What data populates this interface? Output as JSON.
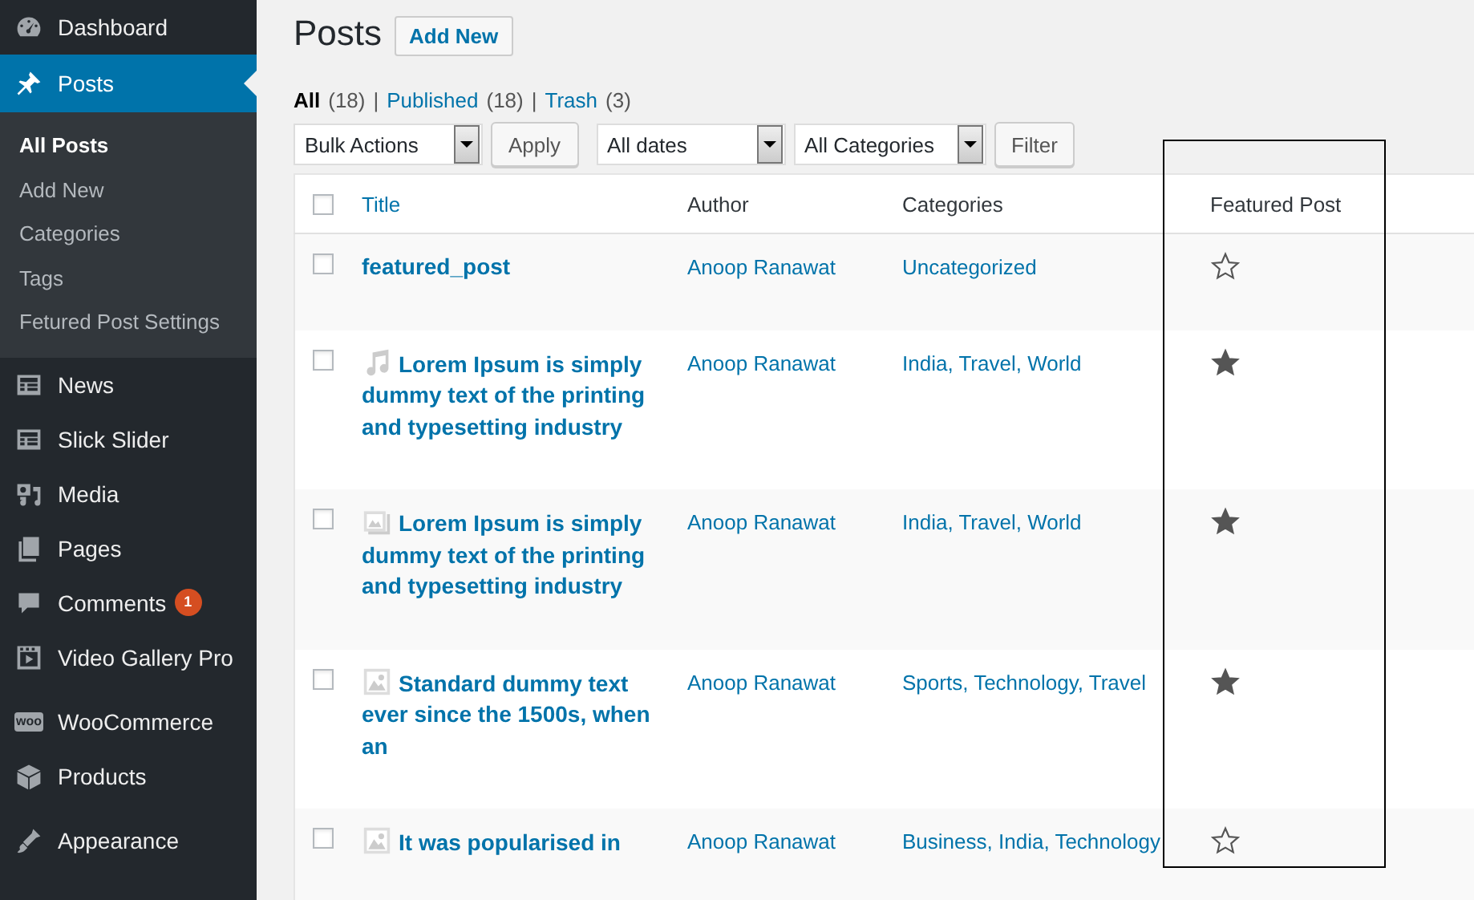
{
  "sidebar": {
    "items": [
      {
        "label": "Dashboard",
        "kind": "dashboard",
        "selected": false
      },
      {
        "label": "Posts",
        "kind": "pin",
        "selected": true,
        "submenu": [
          {
            "label": "All Posts",
            "selected": true
          },
          {
            "label": "Add New",
            "selected": false
          },
          {
            "label": "Categories",
            "selected": false
          },
          {
            "label": "Tags",
            "selected": false
          },
          {
            "label": "Fetured Post Settings",
            "selected": false
          }
        ]
      },
      {
        "label": "News",
        "kind": "list",
        "selected": false
      },
      {
        "label": "Slick Slider",
        "kind": "list",
        "selected": false
      },
      {
        "label": "Media",
        "kind": "media",
        "selected": false
      },
      {
        "label": "Pages",
        "kind": "pages",
        "selected": false
      },
      {
        "label": "Comments",
        "kind": "comment",
        "selected": false,
        "badge": "1"
      },
      {
        "label": "Video Gallery Pro",
        "kind": "video",
        "selected": false
      },
      {
        "label": "WooCommerce",
        "kind": "woo",
        "selected": false,
        "icon_text": "woo"
      },
      {
        "label": "Products",
        "kind": "box",
        "selected": false
      },
      {
        "label": "Appearance",
        "kind": "brush",
        "selected": false
      }
    ]
  },
  "page": {
    "title": "Posts",
    "add_button": "Add New",
    "views": [
      {
        "label": "All",
        "count": "(18)",
        "selected": true
      },
      {
        "label": "Published",
        "count": "(18)",
        "selected": false
      },
      {
        "label": "Trash",
        "count": "(3)",
        "selected": false
      }
    ],
    "view_separator": "|",
    "bulk_select": "Bulk Actions",
    "apply_button": "Apply",
    "date_select": "All dates",
    "category_select": "All Categories",
    "filter_button": "Filter"
  },
  "table": {
    "select_all_checked": false,
    "columns": [
      "Title",
      "Author",
      "Categories",
      "Featured Post"
    ],
    "rows": [
      {
        "checked": false,
        "kind": "standard",
        "title": "featured_post",
        "author": "Anoop Ranawat",
        "categories": [
          "Uncategorized"
        ],
        "featured": false
      },
      {
        "checked": false,
        "kind": "audio",
        "title": "Lorem Ipsum is simply dummy text of the printing and typesetting industry",
        "author": "Anoop Ranawat",
        "categories": [
          "India,",
          "Travel,",
          "World"
        ],
        "featured": true
      },
      {
        "checked": false,
        "kind": "gallery",
        "title": "Lorem Ipsum is simply dummy text of the printing and typesetting industry",
        "author": "Anoop Ranawat",
        "categories": [
          "India,",
          "Travel,",
          "World"
        ],
        "featured": true
      },
      {
        "checked": false,
        "kind": "image",
        "title": "Standard dummy text ever since the 1500s, when an",
        "author": "Anoop Ranawat",
        "categories": [
          "Sports,",
          "Technology,",
          "Travel"
        ],
        "featured": true
      },
      {
        "checked": false,
        "kind": "image",
        "title": "It was popularised in",
        "author": "Anoop Ranawat",
        "categories": [
          "Business,",
          "India,",
          "Technology"
        ],
        "featured": false
      }
    ]
  }
}
